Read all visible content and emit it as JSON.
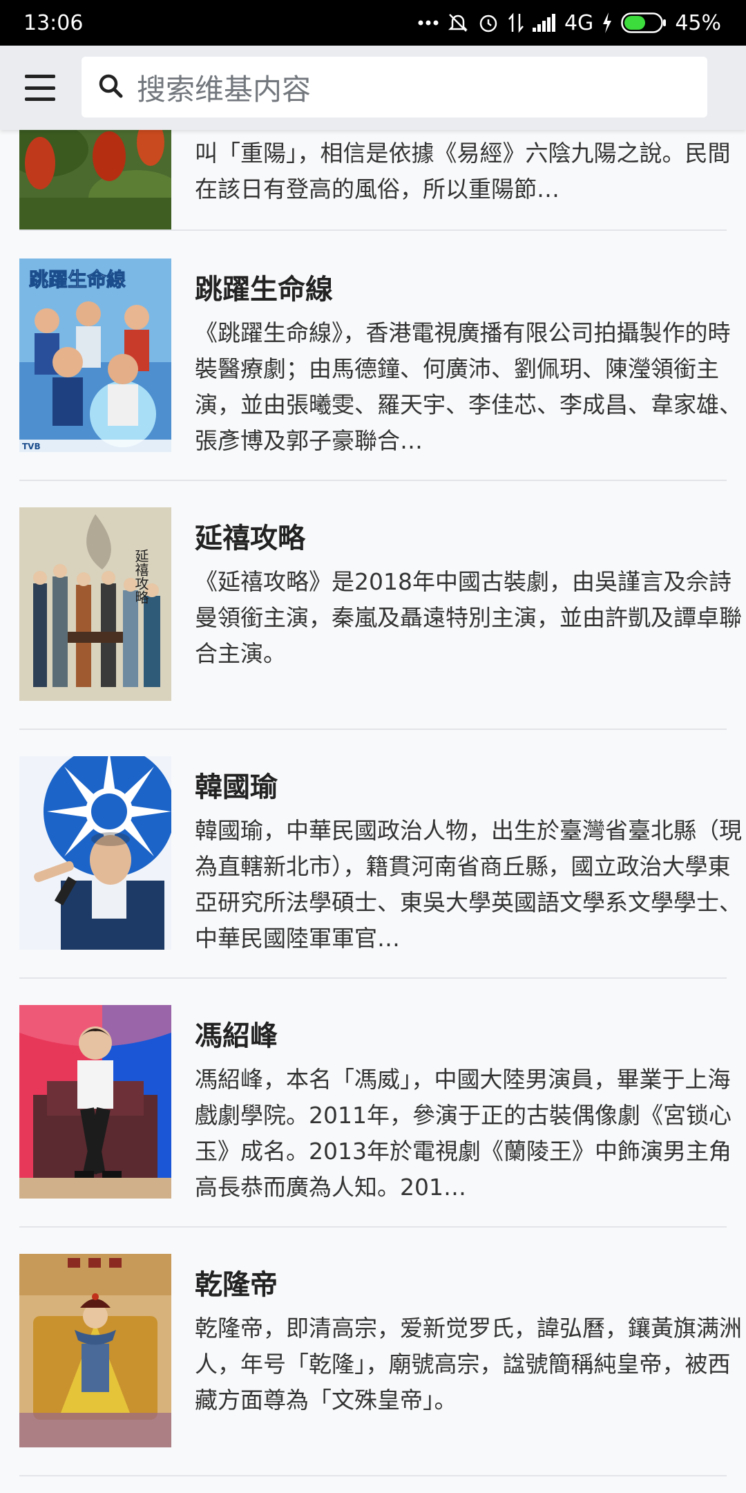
{
  "status_bar": {
    "time": "13:06",
    "network": "4G",
    "battery": "45%",
    "icons": [
      "more-dots-icon",
      "mute-icon",
      "alarm-icon",
      "data-arrows-icon",
      "signal-icon",
      "charging-icon",
      "battery-icon"
    ]
  },
  "app_bar": {
    "search_placeholder": "搜索维基内容",
    "icons": [
      "menu-icon",
      "search-icon"
    ]
  },
  "results": [
    {
      "title": "",
      "description": "叫「重陽」，相信是依據《易經》六陰九陽之說。民間在該日有登高的風俗，所以重陽節…"
    },
    {
      "title": "跳躍生命線",
      "description": "《跳躍生命線》，香港電視廣播有限公司拍攝製作的時裝醫療劇；由馬德鐘、何廣沛、劉佩玥、陳瀅領銜主演，並由張曦雯、羅天宇、李佳芯、李成昌、韋家雄、張彥博及郭子豪聯合…",
      "thumbnail_text": "跳躍生命線",
      "thumbnail_badge": "TVB"
    },
    {
      "title": "延禧攻略",
      "description": "《延禧攻略》是2018年中國古裝劇，由吳謹言及佘詩曼領銜主演，秦嵐及聶遠特別主演，並由許凱及譚卓聯合主演。",
      "thumbnail_text": "延禧攻略"
    },
    {
      "title": "韓國瑜",
      "description": "韓國瑜，中華民國政治人物，出生於臺灣省臺北縣（現為直轄新北市），籍貫河南省商丘縣，國立政治大學東亞研究所法學碩士、東吳大學英國語文學系文學學士、中華民國陸軍軍官…"
    },
    {
      "title": "馮紹峰",
      "description": "馮紹峰，本名「馮威」，中國大陸男演員，畢業于上海戲劇學院。2011年，參演于正的古裝偶像劇《宮锁心玉》成名。2013年於電視劇《蘭陵王》中飾演男主角高長恭而廣為人知。201…"
    },
    {
      "title": "乾隆帝",
      "description": "乾隆帝，即清高宗，爱新觉罗氏，諱弘曆，鑲黃旗满洲人，年号「乾隆」，廟號高宗，諡號簡稱純皇帝，被西藏方面尊為「文殊皇帝」。"
    }
  ]
}
